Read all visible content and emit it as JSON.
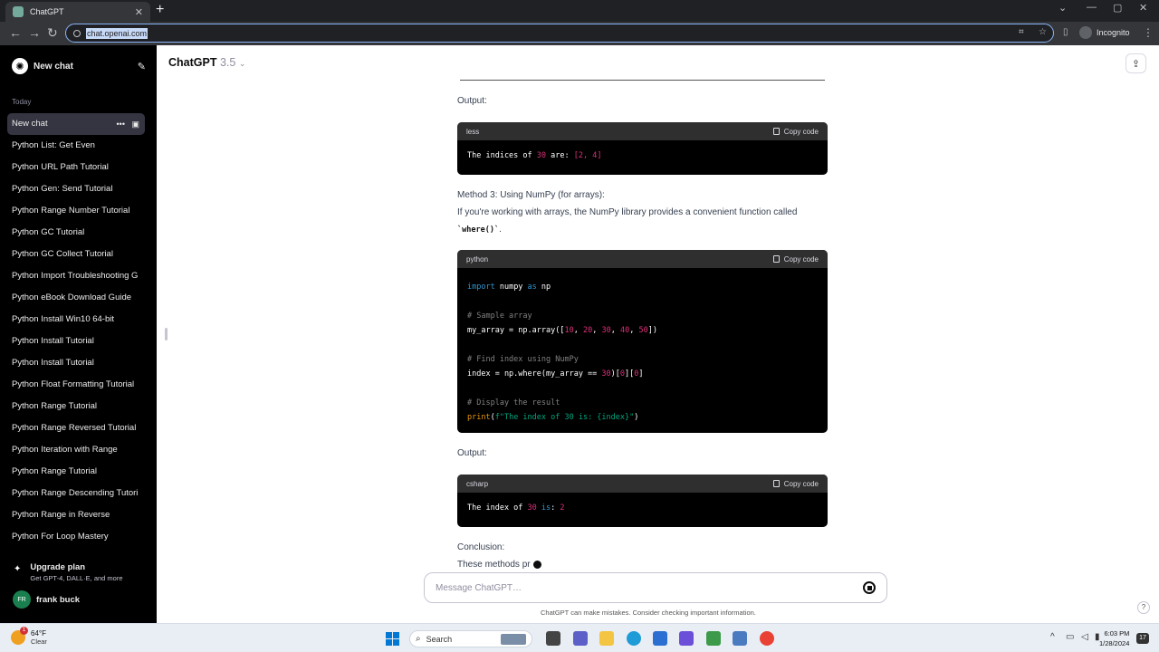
{
  "browser": {
    "tab_title": "ChatGPT",
    "url": "chat.openai.com",
    "incognito_label": "Incognito"
  },
  "sidebar": {
    "new_chat": "New chat",
    "section_label": "Today",
    "items": [
      {
        "label": "New chat",
        "active": true
      },
      {
        "label": "Python List: Get Even"
      },
      {
        "label": "Python URL Path Tutorial"
      },
      {
        "label": "Python Gen: Send Tutorial"
      },
      {
        "label": "Python Range Number Tutorial"
      },
      {
        "label": "Python GC Tutorial"
      },
      {
        "label": "Python GC Collect Tutorial"
      },
      {
        "label": "Python Import Troubleshooting G"
      },
      {
        "label": "Python eBook Download Guide"
      },
      {
        "label": "Python Install Win10 64-bit"
      },
      {
        "label": "Python Install Tutorial"
      },
      {
        "label": "Python Install Tutorial"
      },
      {
        "label": "Python Float Formatting Tutorial"
      },
      {
        "label": "Python Range Tutorial"
      },
      {
        "label": "Python Range Reversed Tutorial"
      },
      {
        "label": "Python Iteration with Range"
      },
      {
        "label": "Python Range Tutorial"
      },
      {
        "label": "Python Range Descending Tutori"
      },
      {
        "label": "Python Range in Reverse"
      },
      {
        "label": "Python For Loop Mastery"
      }
    ],
    "upgrade_title": "Upgrade plan",
    "upgrade_sub": "Get GPT-4, DALL·E, and more",
    "user_initials": "FR",
    "user_name": "frank buck"
  },
  "main": {
    "title": "ChatGPT",
    "version": "3.5",
    "output_label_1": "Output:",
    "code1_lang": "less",
    "copy_label": "Copy code",
    "method3_heading": "Method 3: Using NumPy (for arrays):",
    "method3_text": "If you're working with arrays, the NumPy library provides a convenient function called",
    "method3_code": "`where()`",
    "method3_period": ".",
    "code2_lang": "python",
    "output_label_2": "Output:",
    "code3_lang": "csharp",
    "conclusion_heading": "Conclusion:",
    "conclusion_text": "These methods pr"
  },
  "composer": {
    "placeholder": "Message ChatGPT…",
    "disclaimer": "ChatGPT can make mistakes. Consider checking important information.",
    "help": "?"
  },
  "taskbar": {
    "weather_temp": "64°F",
    "weather_cond": "Clear",
    "weather_badge": "1",
    "search_label": "Search",
    "time": "6:03 PM",
    "date": "1/28/2024",
    "notif_count": "17"
  }
}
